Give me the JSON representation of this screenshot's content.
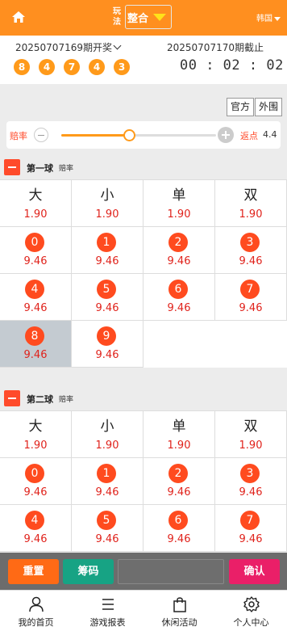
{
  "header": {
    "play_label": "玩法",
    "mode": "整合",
    "region": "韩国"
  },
  "draw": {
    "prev_issue": "20250707169期开奖",
    "result": [
      "8",
      "4",
      "7",
      "4",
      "3"
    ],
    "next_issue": "20250707170期截止",
    "countdown": "00 : 02 : 02"
  },
  "source_tabs": [
    "官方",
    "外围"
  ],
  "odds_slider": {
    "label": "赔率",
    "value_fraction": 0.44,
    "rebate_label": "返点",
    "rebate_value": "4.4"
  },
  "sections": [
    {
      "title": "第一球",
      "subtitle": "赔率",
      "cells": [
        {
          "label": "大",
          "odds": "1.90",
          "kind": "text"
        },
        {
          "label": "小",
          "odds": "1.90",
          "kind": "text"
        },
        {
          "label": "单",
          "odds": "1.90",
          "kind": "text"
        },
        {
          "label": "双",
          "odds": "1.90",
          "kind": "text"
        },
        {
          "label": "0",
          "odds": "9.46",
          "kind": "ball"
        },
        {
          "label": "1",
          "odds": "9.46",
          "kind": "ball"
        },
        {
          "label": "2",
          "odds": "9.46",
          "kind": "ball"
        },
        {
          "label": "3",
          "odds": "9.46",
          "kind": "ball"
        },
        {
          "label": "4",
          "odds": "9.46",
          "kind": "ball"
        },
        {
          "label": "5",
          "odds": "9.46",
          "kind": "ball"
        },
        {
          "label": "6",
          "odds": "9.46",
          "kind": "ball"
        },
        {
          "label": "7",
          "odds": "9.46",
          "kind": "ball"
        },
        {
          "label": "8",
          "odds": "9.46",
          "kind": "ball",
          "selected": true
        },
        {
          "label": "9",
          "odds": "9.46",
          "kind": "ball"
        }
      ]
    },
    {
      "title": "第二球",
      "subtitle": "赔率",
      "cells": [
        {
          "label": "大",
          "odds": "1.90",
          "kind": "text"
        },
        {
          "label": "小",
          "odds": "1.90",
          "kind": "text"
        },
        {
          "label": "单",
          "odds": "1.90",
          "kind": "text"
        },
        {
          "label": "双",
          "odds": "1.90",
          "kind": "text"
        },
        {
          "label": "0",
          "odds": "9.46",
          "kind": "ball"
        },
        {
          "label": "1",
          "odds": "9.46",
          "kind": "ball"
        },
        {
          "label": "2",
          "odds": "9.46",
          "kind": "ball"
        },
        {
          "label": "3",
          "odds": "9.46",
          "kind": "ball"
        },
        {
          "label": "4",
          "odds": "9.46",
          "kind": "ball"
        },
        {
          "label": "5",
          "odds": "9.46",
          "kind": "ball"
        },
        {
          "label": "6",
          "odds": "9.46",
          "kind": "ball"
        },
        {
          "label": "7",
          "odds": "9.46",
          "kind": "ball"
        }
      ]
    }
  ],
  "bet_bar": {
    "reset": "重置",
    "chips": "筹码",
    "confirm": "确认"
  },
  "bottom_nav": [
    {
      "label": "我的首页",
      "icon": "user-icon"
    },
    {
      "label": "游戏报表",
      "icon": "list-icon"
    },
    {
      "label": "休闲活动",
      "icon": "bag-icon"
    },
    {
      "label": "个人中心",
      "icon": "gear-icon"
    }
  ],
  "colors": {
    "brand": "#ff8f1f",
    "ball": "#ff4b1f",
    "odds": "#e0221b",
    "confirm": "#ea1f68",
    "chips": "#17a384"
  }
}
